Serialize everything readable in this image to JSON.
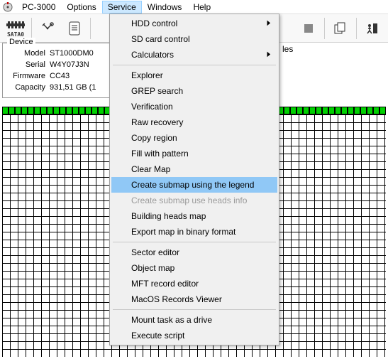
{
  "menubar": {
    "app": "PC-3000",
    "items": [
      "PC-3000",
      "Options",
      "Service",
      "Windows",
      "Help"
    ],
    "open_index": 2
  },
  "toolbar": {
    "sata_label": "SATA0"
  },
  "device": {
    "legend": "Device",
    "model_label": "Model",
    "model": "ST1000DM0",
    "serial_label": "Serial",
    "serial": "W4Y07J3N",
    "firmware_label": "Firmware",
    "firmware": "CC43",
    "capacity_label": "Capacity",
    "capacity": "931,51 GB (1"
  },
  "right_tab": "les",
  "dropdown": {
    "groups": [
      {
        "items": [
          {
            "label": "HDD control",
            "submenu": true
          },
          {
            "label": "SD card control"
          },
          {
            "label": "Calculators",
            "submenu": true
          }
        ]
      },
      {
        "items": [
          {
            "label": "Explorer"
          },
          {
            "label": "GREP search"
          },
          {
            "label": "Verification"
          },
          {
            "label": "Raw recovery"
          },
          {
            "label": "Copy region"
          },
          {
            "label": "Fill with pattern"
          },
          {
            "label": "Clear Map"
          },
          {
            "label": "Create submap using the legend",
            "highlight": true
          },
          {
            "label": "Create submap use heads info",
            "disabled": true
          },
          {
            "label": "Building heads map"
          },
          {
            "label": "Export map in binary format"
          }
        ]
      },
      {
        "items": [
          {
            "label": "Sector editor"
          },
          {
            "label": "Object map"
          },
          {
            "label": "MFT record editor"
          },
          {
            "label": "MacOS Records Viewer"
          }
        ]
      },
      {
        "items": [
          {
            "label": "Mount task as a drive"
          },
          {
            "label": "Execute script"
          }
        ]
      }
    ]
  }
}
